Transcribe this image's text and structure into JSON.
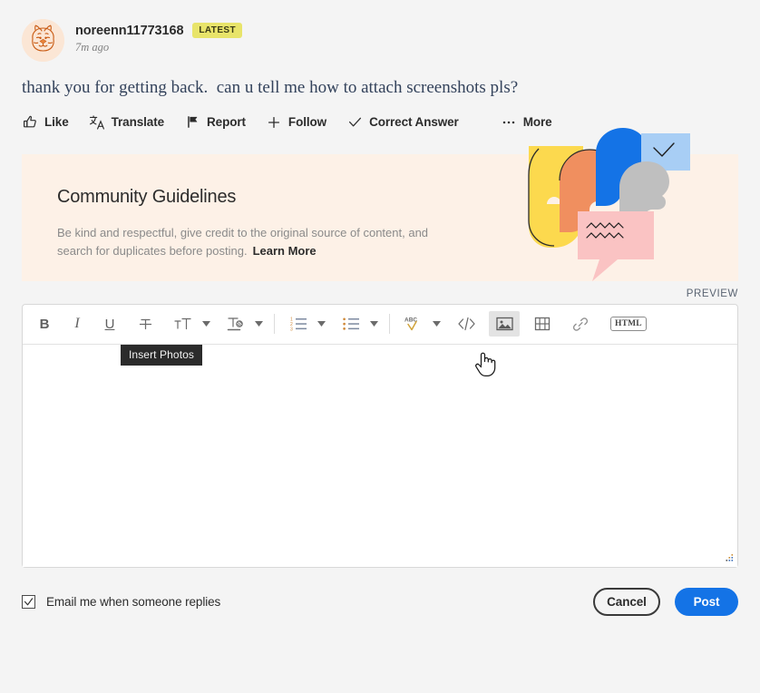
{
  "post": {
    "author": "noreenn11773168",
    "badge": "LATEST",
    "timestamp": "7m ago",
    "body": "thank you for getting back.  can u tell me how to attach screenshots pls?",
    "avatar_icon": "tiger-avatar-icon"
  },
  "actions": [
    {
      "label": "Like",
      "icon": "thumbs-up-icon"
    },
    {
      "label": "Translate",
      "icon": "translate-icon"
    },
    {
      "label": "Report",
      "icon": "flag-icon"
    },
    {
      "label": "Follow",
      "icon": "plus-icon"
    },
    {
      "label": "Correct Answer",
      "icon": "check-icon"
    },
    {
      "label": "More",
      "icon": "ellipsis-icon"
    }
  ],
  "guidelines": {
    "title": "Community Guidelines",
    "description": "Be kind and respectful, give credit to the original source of content, and search for duplicates before posting.",
    "link_label": "Learn More",
    "background": "#fdf1e7",
    "illustration": "community-people-illustration"
  },
  "editor": {
    "preview_label": "PREVIEW",
    "content": "",
    "placeholder": "",
    "tooltip": "Insert Photos",
    "active_tool": "insert-photos",
    "toolbar": [
      {
        "name": "bold-button",
        "glyph": "B",
        "type": "letter",
        "caret": false
      },
      {
        "name": "italic-button",
        "glyph": "I",
        "type": "letter",
        "caret": false
      },
      {
        "name": "underline-button",
        "glyph": "U",
        "type": "letter",
        "caret": false
      },
      {
        "name": "strikethrough-button",
        "glyph": "strikethrough-icon",
        "type": "icon",
        "caret": false
      },
      {
        "name": "font-size-button",
        "glyph": "font-size-icon",
        "type": "icon",
        "caret": true
      },
      {
        "name": "text-color-button",
        "glyph": "text-color-icon",
        "type": "icon",
        "caret": true
      },
      {
        "name": "numbered-list-button",
        "glyph": "ordered-list-icon",
        "type": "icon",
        "caret": true
      },
      {
        "name": "bulleted-list-button",
        "glyph": "unordered-list-icon",
        "type": "icon",
        "caret": true
      },
      {
        "name": "spellcheck-button",
        "glyph": "spellcheck-icon",
        "type": "icon",
        "caret": true
      },
      {
        "name": "code-button",
        "glyph": "code-icon",
        "type": "icon",
        "caret": false
      },
      {
        "name": "insert-photos-button",
        "glyph": "image-icon",
        "type": "icon",
        "caret": false
      },
      {
        "name": "insert-video-button",
        "glyph": "film-icon",
        "type": "icon",
        "caret": false
      },
      {
        "name": "insert-link-button",
        "glyph": "link-icon",
        "type": "icon",
        "caret": false
      },
      {
        "name": "html-button",
        "glyph": "HTML",
        "type": "html",
        "caret": false
      }
    ]
  },
  "footer": {
    "checkbox_label": "Email me when someone replies",
    "checkbox_checked": true,
    "cancel_label": "Cancel",
    "post_label": "Post",
    "post_color": "#1473e6"
  }
}
